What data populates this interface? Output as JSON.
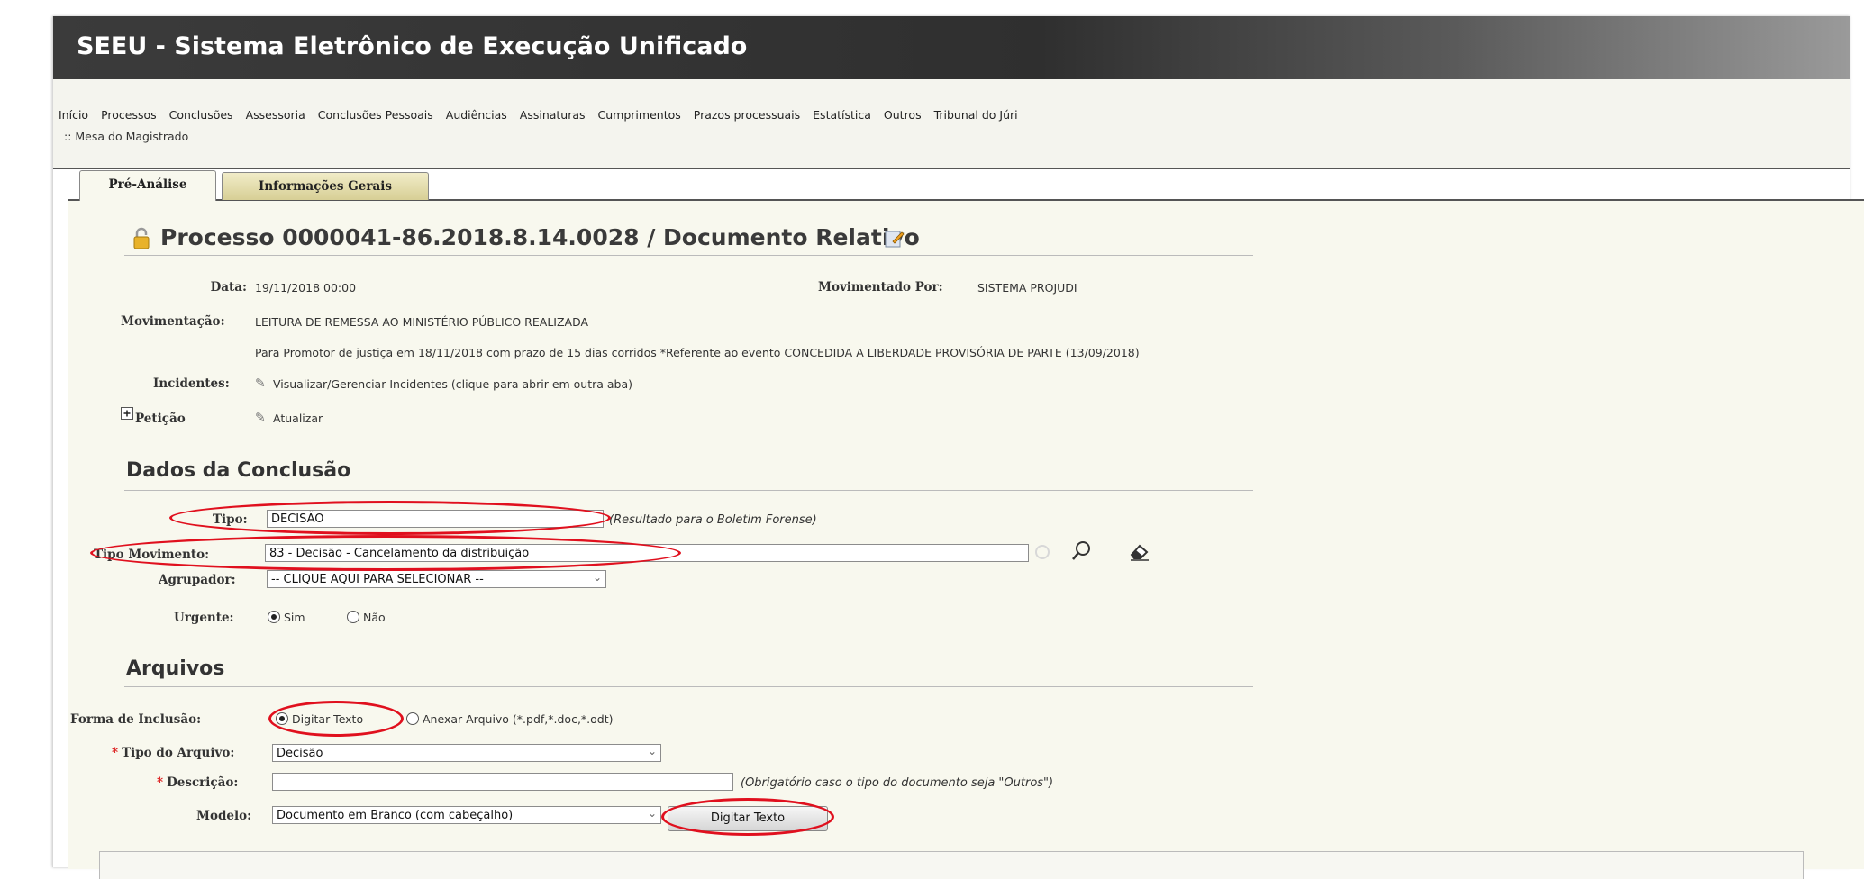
{
  "app": {
    "title": "SEEU - Sistema Eletrônico de Execução Unificado"
  },
  "menu": {
    "items": [
      "Início",
      "Processos",
      "Conclusões",
      "Assessoria",
      "Conclusões Pessoais",
      "Audiências",
      "Assinaturas",
      "Cumprimentos",
      "Prazos processuais",
      "Estatística",
      "Outros",
      "Tribunal do Júri"
    ],
    "breadcrumb": ":: Mesa do Magistrado"
  },
  "tabs": [
    "Pré-Análise",
    "Informações Gerais"
  ],
  "process": {
    "heading": "Processo 0000041-86.2018.8.14.0028 / Documento Relativo",
    "data_label": "Data:",
    "data_value": "19/11/2018 00:00",
    "movimentado_label": "Movimentado Por:",
    "movimentado_value": "SISTEMA PROJUDI",
    "movimentacao_label": "Movimentação:",
    "movimentacao_value": "LEITURA DE REMESSA AO MINISTÉRIO PÚBLICO REALIZADA",
    "movimentacao_detail": "Para Promotor de justiça em 18/11/2018 com prazo de 15 dias corridos *Referente ao evento CONCEDIDA A LIBERDADE PROVISÓRIA DE PARTE (13/09/2018)",
    "incidentes_label": "Incidentes:",
    "incidentes_link": "Visualizar/Gerenciar Incidentes (clique para abrir em outra aba)",
    "peticao_label": "Petição",
    "peticao_link": "Atualizar"
  },
  "conclusao": {
    "section_title": "Dados da Conclusão",
    "tipo_label": "Tipo:",
    "tipo_value": "DECISÃO",
    "tipo_hint": "(Resultado para o Boletim Forense)",
    "tipo_mov_label": "Tipo Movimento:",
    "tipo_mov_value": "83 - Decisão - Cancelamento da distribuição",
    "agrupador_label": "Agrupador:",
    "agrupador_value": "-- CLIQUE AQUI PARA SELECIONAR --",
    "urgente_label": "Urgente:",
    "urgente_sim": "Sim",
    "urgente_nao": "Não"
  },
  "arquivos": {
    "section_title": "Arquivos",
    "forma_label": "Forma de Inclusão:",
    "forma_opt1": "Digitar Texto",
    "forma_opt2": "Anexar Arquivo (*.pdf,*.doc,*.odt)",
    "tipo_arquivo_label": "Tipo do Arquivo:",
    "tipo_arquivo_value": "Decisão",
    "descricao_label": "Descrição:",
    "descricao_value": "",
    "descricao_hint": "(Obrigatório caso o tipo do documento seja \"Outros\")",
    "modelo_label": "Modelo:",
    "modelo_value": "Documento em Branco (com cabeçalho)",
    "digitar_button": "Digitar Texto"
  },
  "colors": {
    "annotation": "#e0101e",
    "titlebar": "#2f2f2f",
    "panel": "#f8f8ee"
  }
}
